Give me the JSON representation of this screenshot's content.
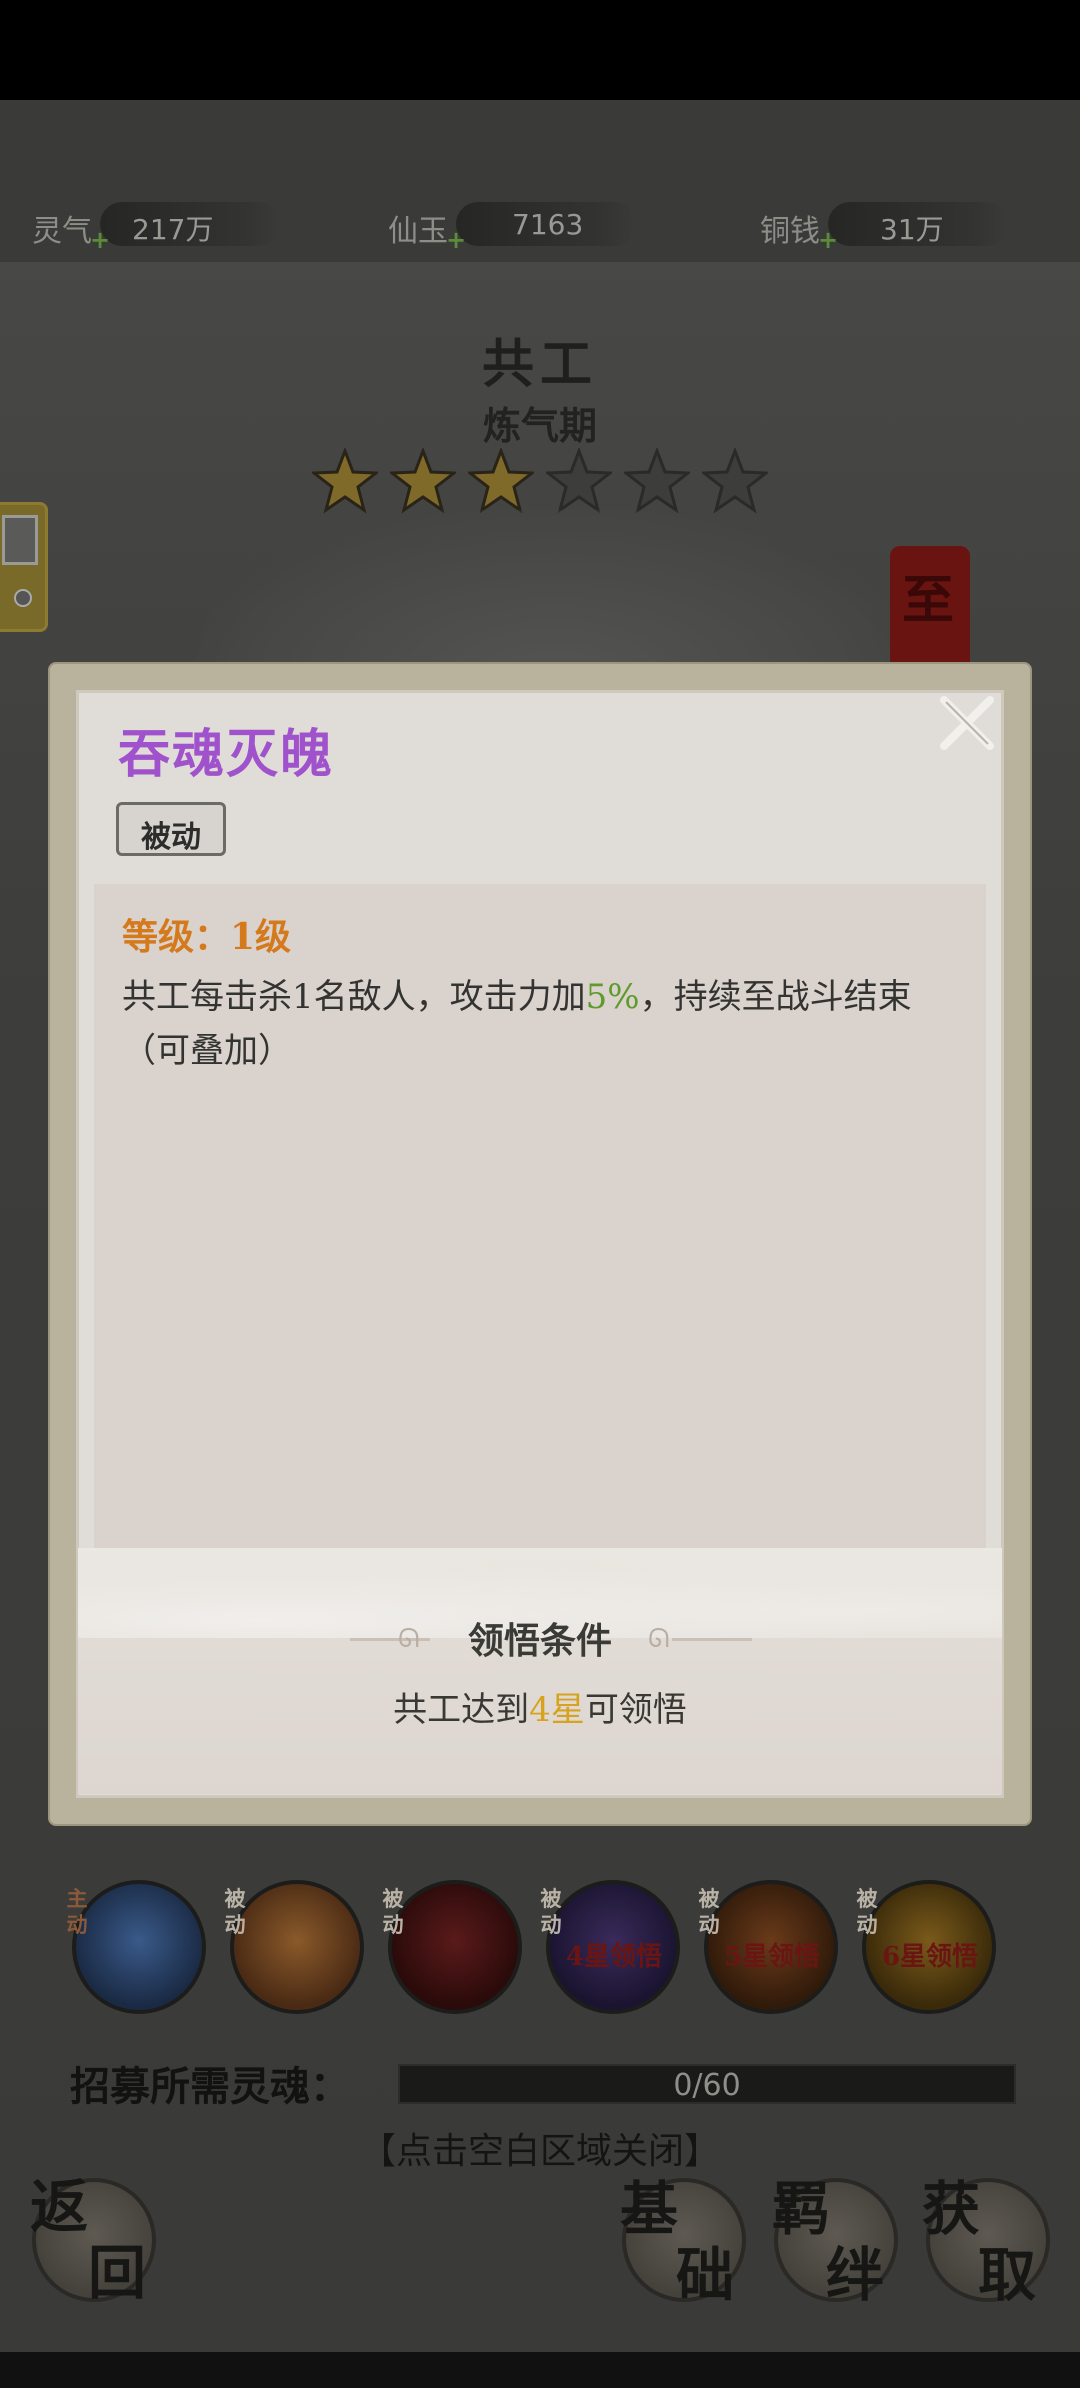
{
  "resources": [
    {
      "name": "灵气",
      "value": "217万"
    },
    {
      "name": "仙玉",
      "value": "7163"
    },
    {
      "name": "铜钱",
      "value": "31万"
    }
  ],
  "hero": {
    "name": "共工",
    "realm": "炼气期",
    "stars_filled": 3,
    "stars_total": 6,
    "banner_char": "至"
  },
  "popup": {
    "skill_name": "吞魂灭魄",
    "skill_type": "被动",
    "level_text": "等级：1级",
    "desc_pre": "共工每击杀1名敌人，攻击力加",
    "desc_value": "5%",
    "desc_post": "，持续至战斗结束（可叠加）",
    "condition_title": "领悟条件",
    "condition_pre": "共工达到",
    "condition_value": "4星",
    "condition_post": "可领悟"
  },
  "skills": [
    {
      "type": "主动",
      "lock": ""
    },
    {
      "type": "被动",
      "lock": ""
    },
    {
      "type": "被动",
      "lock": ""
    },
    {
      "type": "被动",
      "lock": "4星领悟"
    },
    {
      "type": "被动",
      "lock": "5星领悟"
    },
    {
      "type": "被动",
      "lock": "6星领悟"
    }
  ],
  "recruit": {
    "label": "招募所需灵魂：",
    "progress_text": "0/60",
    "current": 0,
    "total": 60
  },
  "hint": "【点击空白区域关闭】",
  "buttons": {
    "back": [
      "返",
      "回"
    ],
    "basic": [
      "基",
      "础"
    ],
    "bond": [
      "羁",
      "绊"
    ],
    "obtain": [
      "获",
      "取"
    ]
  }
}
